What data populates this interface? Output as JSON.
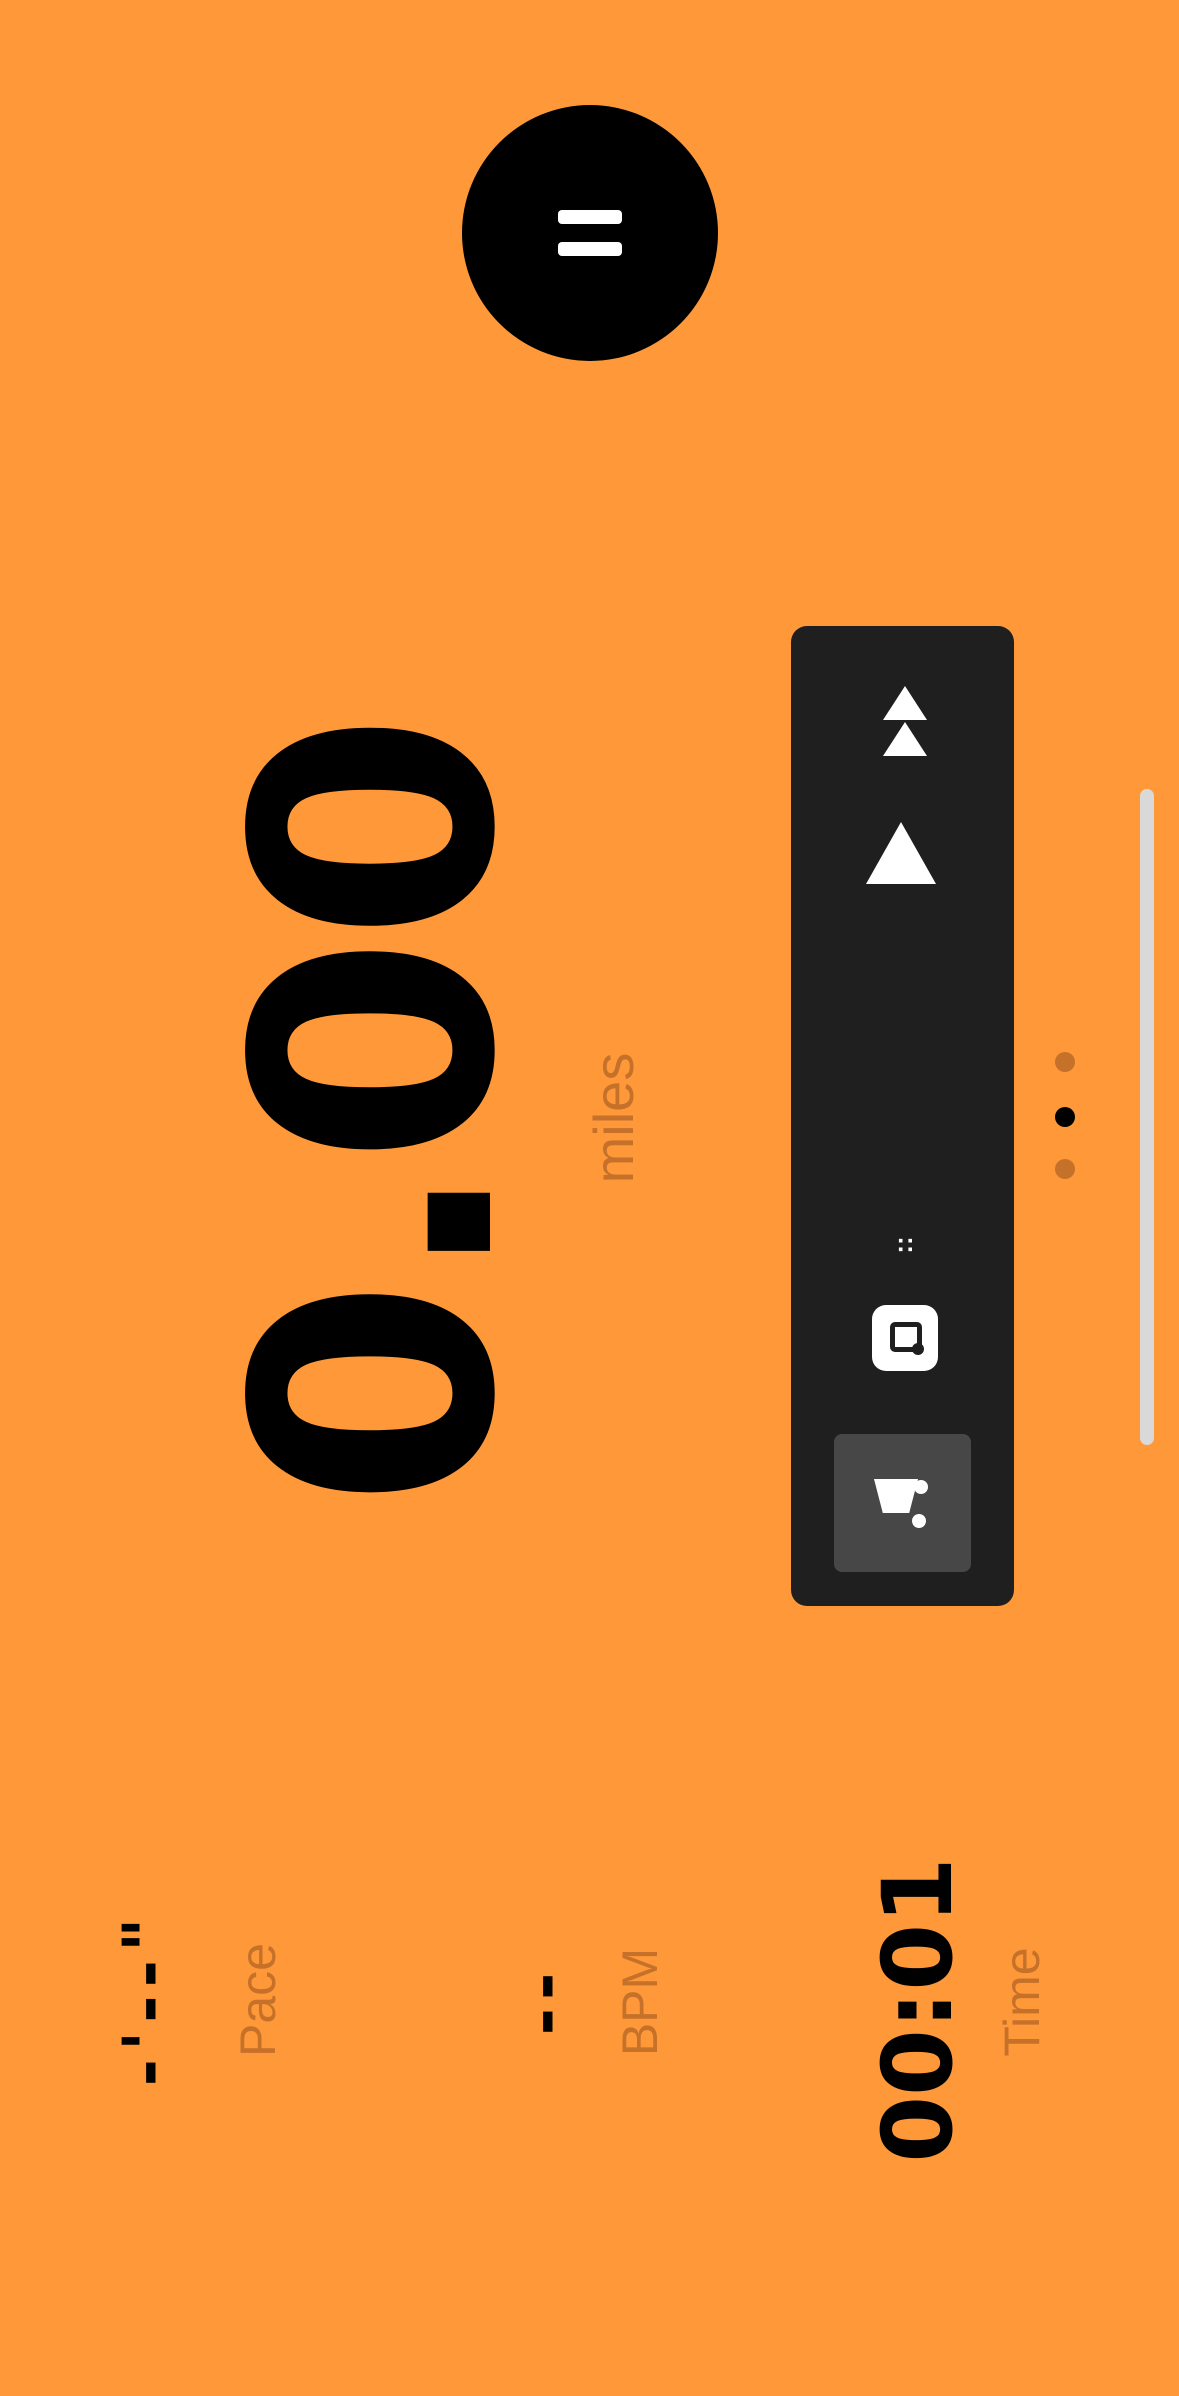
{
  "pause_button": {
    "icon": "pause-icon"
  },
  "distance": {
    "value": "0.00",
    "unit": "miles"
  },
  "controls": {
    "speed_up_icon": "double-up-arrow-icon",
    "up_icon": "up-arrow-icon",
    "small_label": "::",
    "app_icon": "route-icon",
    "selected_icon": "cart-icon"
  },
  "pagination": {
    "total": 3,
    "active": 2
  },
  "stats": {
    "pace": {
      "value": "-'--\"",
      "label": "Pace"
    },
    "bpm": {
      "value": "--",
      "label": "BPM"
    },
    "time": {
      "value": "00:01",
      "label": "Time"
    }
  },
  "colors": {
    "background": "#FF9838",
    "panel": "#1F1F1F",
    "muted_label": "#C5712A"
  }
}
